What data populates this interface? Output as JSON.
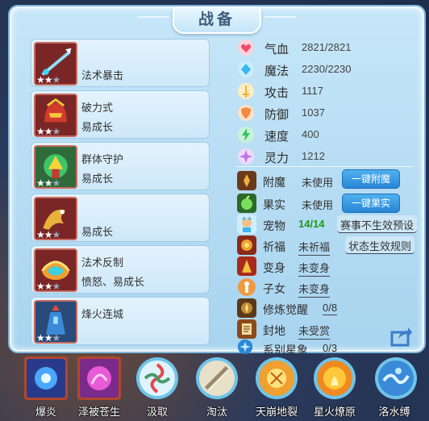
{
  "panel": {
    "title": "战备"
  },
  "skills": [
    {
      "line1": "法术暴击",
      "line2": "",
      "stars_on": 2,
      "stars_total": 3
    },
    {
      "line1": "破力式",
      "line2": "易成长",
      "stars_on": 2,
      "stars_total": 3
    },
    {
      "line1": "群体守护",
      "line2": "易成长",
      "stars_on": 2,
      "stars_total": 3
    },
    {
      "line1": "",
      "line2": "易成长",
      "stars_on": 2,
      "stars_total": 3
    },
    {
      "line1": "法术反制",
      "line2": "愤怒、易成长",
      "stars_on": 2,
      "stars_total": 3
    },
    {
      "line1": "烽火连城",
      "line2": "",
      "stars_on": 2,
      "stars_total": 3
    }
  ],
  "stats": [
    {
      "label": "气血",
      "value": "2821/2821",
      "icon": "heart-icon",
      "color": "#f04a6a"
    },
    {
      "label": "魔法",
      "value": "2230/2230",
      "icon": "diamond-icon",
      "color": "#3ab6f0"
    },
    {
      "label": "攻击",
      "value": "1117",
      "icon": "sword-icon",
      "color": "#f2b030"
    },
    {
      "label": "防御",
      "value": "1037",
      "icon": "shield-icon",
      "color": "#f08a40"
    },
    {
      "label": "速度",
      "value": "400",
      "icon": "lightning-icon",
      "color": "#2ec46a"
    },
    {
      "label": "灵力",
      "value": "1212",
      "icon": "spirit-icon",
      "color": "#c070e8"
    }
  ],
  "rows": {
    "enchant": {
      "label": "附魔",
      "value": "未使用",
      "button": "一键附魔"
    },
    "fruit": {
      "label": "果实",
      "value": "未使用",
      "button": "一键果实"
    },
    "pet": {
      "label": "宠物",
      "value": "14/14",
      "link": "赛事不生效预设",
      "value_color": "#1f9a1f"
    },
    "blessing": {
      "label": "祈福",
      "value": "未祈福",
      "link": "状态生效规则"
    },
    "transform": {
      "label": "变身",
      "value": "未变身"
    },
    "child": {
      "label": "子女",
      "value": "未变身"
    },
    "cultivation": {
      "label": "修炼觉醒",
      "value": "0/8"
    },
    "fief": {
      "label": "封地",
      "value": "未受赏"
    },
    "constellation": {
      "label": "系别星象",
      "value": "0/3"
    }
  },
  "bottom_skills": [
    {
      "label": "爆炎",
      "icon": "blast-icon",
      "selected": true
    },
    {
      "label": "泽被苍生",
      "icon": "blessing-orb-icon",
      "selected": true
    },
    {
      "label": "汲取",
      "icon": "absorb-icon",
      "selected": false
    },
    {
      "label": "淘汰",
      "icon": "eliminate-icon",
      "selected": false
    },
    {
      "label": "天崩地裂",
      "icon": "quake-icon",
      "selected": false
    },
    {
      "label": "星火燎原",
      "icon": "starfire-icon",
      "selected": false
    },
    {
      "label": "洛水缚",
      "icon": "water-bind-icon",
      "selected": false
    }
  ]
}
